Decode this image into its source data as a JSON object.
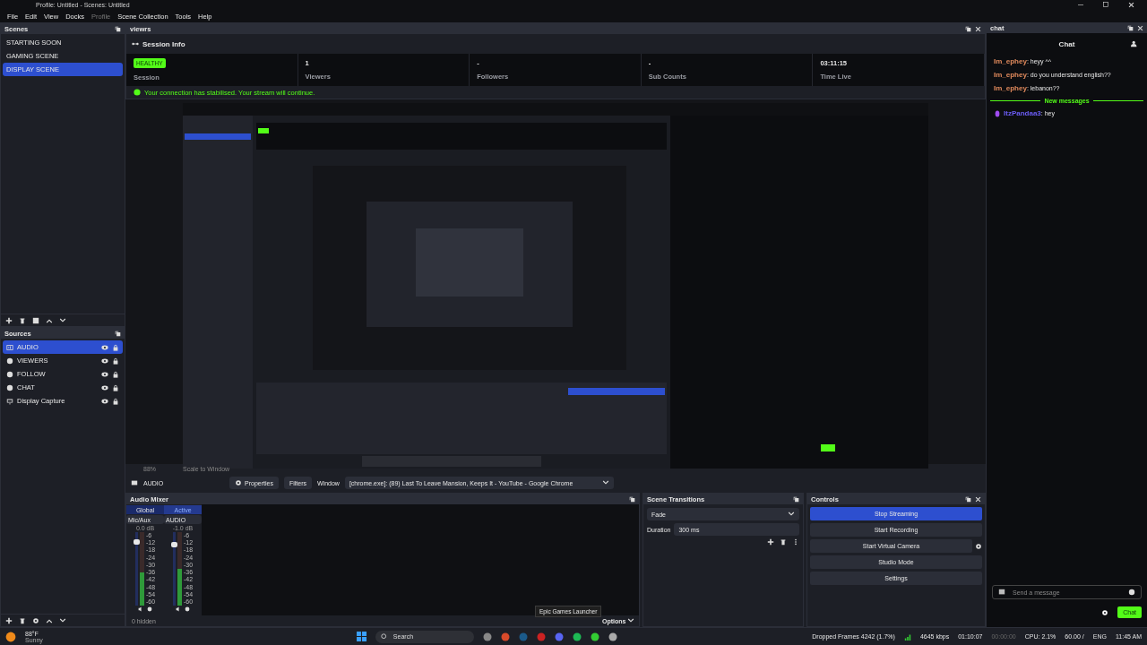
{
  "window": {
    "title": "Profile: Untitled - Scenes: Untitled"
  },
  "menu": [
    {
      "label": "File",
      "disabled": false
    },
    {
      "label": "Edit",
      "disabled": false
    },
    {
      "label": "View",
      "disabled": false
    },
    {
      "label": "Docks",
      "disabled": false
    },
    {
      "label": "Profile",
      "disabled": true
    },
    {
      "label": "Scene Collection",
      "disabled": false
    },
    {
      "label": "Tools",
      "disabled": false
    },
    {
      "label": "Help",
      "disabled": false
    }
  ],
  "scenes": {
    "title": "Scenes",
    "items": [
      {
        "label": "STARTING SOON",
        "selected": false
      },
      {
        "label": "GAMING SCENE",
        "selected": false
      },
      {
        "label": "DISPLAY SCENE",
        "selected": true
      }
    ]
  },
  "sources": {
    "title": "Sources",
    "items": [
      {
        "label": "AUDIO",
        "kind": "audio",
        "selected": true
      },
      {
        "label": "VIEWERS",
        "kind": "browser",
        "selected": false
      },
      {
        "label": "FOLLOW",
        "kind": "browser",
        "selected": false
      },
      {
        "label": "CHAT",
        "kind": "browser",
        "selected": false
      },
      {
        "label": "Display Capture",
        "kind": "display",
        "selected": false
      }
    ]
  },
  "viewers_dock": {
    "title": "viewrs",
    "heading": "Session Info",
    "stats": [
      {
        "kind": "badge",
        "value": "HEALTHY",
        "label": "Session"
      },
      {
        "kind": "text",
        "value": "1",
        "label": "Viewers"
      },
      {
        "kind": "text",
        "value": "-",
        "label": "Followers"
      },
      {
        "kind": "text",
        "value": "-",
        "label": "Sub Counts"
      },
      {
        "kind": "text",
        "value": "03:11:15",
        "label": "Time Live"
      }
    ],
    "notice": "Your connection has stabilised. Your stream will continue."
  },
  "preview": {
    "kind": "picture",
    "zoom": "88%",
    "scale": "Scale to Window"
  },
  "source_bar": {
    "source": "AUDIO",
    "properties": "Properties",
    "filters": "Filters",
    "window_label": "Window",
    "window_value": "[chrome.exe]: (89) Last To Leave Mansion, Keeps It - YouTube - Google Chrome"
  },
  "audio_mixer": {
    "title": "Audio Mixer",
    "tabs": [
      {
        "label": "Global",
        "selected": false
      },
      {
        "label": "Active",
        "selected": true
      }
    ],
    "channels": [
      {
        "name": "Mic/Aux",
        "reading": "0.0 dB",
        "level": 0.9,
        "meter": {
          "level": 0.45
        },
        "scale": [
          "-6",
          "-12",
          "-18",
          "-24",
          "-30",
          "-36",
          "-42",
          "-48",
          "-54",
          "-60"
        ]
      },
      {
        "name": "AUDIO",
        "reading": "-1.0 dB",
        "level": 0.85,
        "meter": {
          "level": 0.5
        },
        "scale": [
          "-6",
          "-12",
          "-18",
          "-24",
          "-30",
          "-36",
          "-42",
          "-48",
          "-54",
          "-60"
        ]
      }
    ],
    "hidden": "0 hidden"
  },
  "scene_transitions": {
    "title": "Scene Transitions",
    "transition": "Fade",
    "duration_label": "Duration",
    "duration": "300 ms"
  },
  "controls": {
    "title": "Controls",
    "buttons": [
      {
        "label": "Stop Streaming",
        "active": true,
        "settings": false
      },
      {
        "label": "Start Recording",
        "active": false,
        "settings": false
      },
      {
        "label": "Start Virtual Camera",
        "active": false,
        "settings": true
      },
      {
        "label": "Studio Mode",
        "active": false,
        "settings": false
      },
      {
        "label": "Settings",
        "active": false,
        "settings": false
      }
    ]
  },
  "chat": {
    "title": "chat",
    "heading": "Chat",
    "messages": [
      {
        "kind": "message",
        "user": "Im_ephey",
        "text": ": heyy ^^",
        "color": "#e08a5c"
      },
      {
        "kind": "message",
        "user": "Im_ephey",
        "text": ": do you understand english??",
        "color": "#e08a5c"
      },
      {
        "kind": "message",
        "user": "Im_ephey",
        "text": ": lebanon??",
        "color": "#e08a5c"
      },
      {
        "kind": "divider",
        "text": "New messages"
      },
      {
        "kind": "message",
        "user": "ItzPandaa3",
        "text": ": hey",
        "color": "#6a5cf2"
      }
    ],
    "placeholder": "Send a message",
    "send": "Chat"
  },
  "tooltip": "Epic Games Launcher",
  "options": "Options",
  "taskbar": {
    "search": "Search",
    "weather_temp": "88°F",
    "weather_text": "Sunny",
    "language": "ENG",
    "time": "11:45 AM"
  },
  "status_bar": {
    "dropped": "Dropped Frames 4242 (1.7%)",
    "bitrate": "4645 kbps",
    "live_time": "01:10:07",
    "rec_time": "00:00:00",
    "cpu": "CPU: 2.1%",
    "fps": "60.00 /"
  }
}
